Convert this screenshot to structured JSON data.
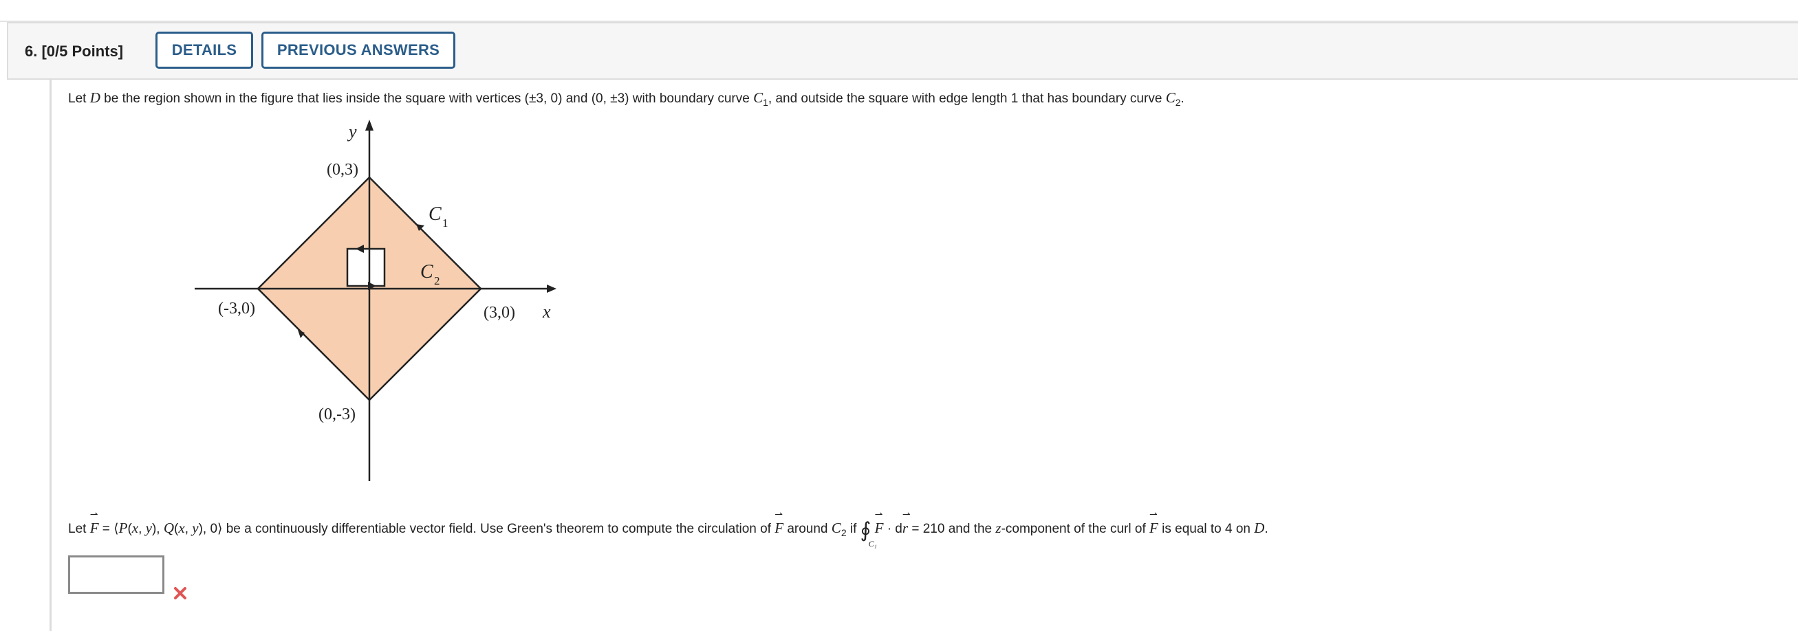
{
  "question": {
    "number_label": "6.  [0/5 Points]",
    "details_label": "DETAILS",
    "previous_answers_label": "PREVIOUS ANSWERS"
  },
  "prompt1": {
    "t1": "Let ",
    "D": "D",
    "t2": " be the region shown in the figure that lies inside the square with vertices (±3, 0) and (0, ±3) with boundary curve ",
    "C": "C",
    "sub1": "1",
    "t3": ", and outside the square with edge length 1 that has boundary curve ",
    "C2": "C",
    "sub2": "2",
    "t4": "."
  },
  "prompt2": {
    "t1": "Let ",
    "F1": "F",
    "t2": " = ⟨",
    "P": "P",
    "t3": "(",
    "x1": "x",
    "t4": ", ",
    "y1": "y",
    "t5": "), ",
    "Q": "Q",
    "t6": "(",
    "x2": "x",
    "t7": ", ",
    "y2": "y",
    "t8": "), 0⟩ be a continuously differentiable vector field. Use Green's theorem to compute the circulation of ",
    "F2": "F",
    "t9": " around ",
    "C": "C",
    "csub": "2",
    "t10": " if ",
    "oint": "∮",
    "oint_sub": "C₁",
    "F3": "F",
    "t11": " · d",
    "r": "r",
    "t12": " = 210 and the ",
    "z": "z",
    "t13": "-component of the curl of ",
    "F4": "F",
    "t14": " is equal to 4 on ",
    "D": "D",
    "t15": "."
  },
  "figure": {
    "y_label": "y",
    "x_label": "x",
    "top_vertex": "(0,3)",
    "bottom_vertex": "(0,-3)",
    "left_vertex": "(-3,0)",
    "right_vertex": "(3,0)",
    "c1_label": "C",
    "c1_sub": "1",
    "c2_label": "C",
    "c2_sub": "2",
    "fill_color": "#f7cfb0"
  },
  "answer": {
    "value": "",
    "status_icon": "red-x-icon",
    "status_color": "#e05555"
  }
}
